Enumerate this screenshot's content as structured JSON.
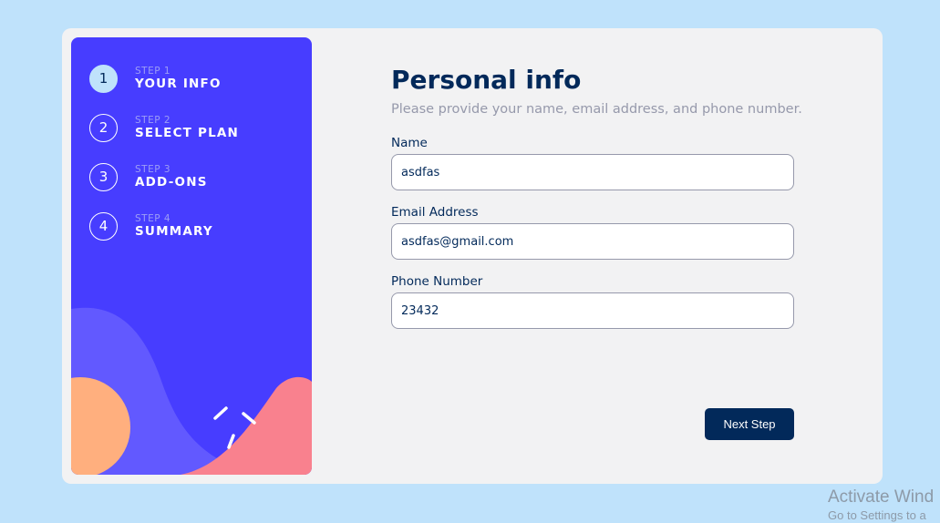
{
  "sidebar": {
    "steps": [
      {
        "number": "1",
        "label": "STEP 1",
        "name": "YOUR INFO",
        "active": true
      },
      {
        "number": "2",
        "label": "STEP 2",
        "name": "SELECT PLAN",
        "active": false
      },
      {
        "number": "3",
        "label": "STEP 3",
        "name": "ADD-ONS",
        "active": false
      },
      {
        "number": "4",
        "label": "STEP 4",
        "name": "SUMMARY",
        "active": false
      }
    ]
  },
  "main": {
    "title": "Personal info",
    "subtitle": "Please provide your name, email address, and phone number.",
    "fields": {
      "name": {
        "label": "Name",
        "value": "asdfas"
      },
      "email": {
        "label": "Email Address",
        "value": "asdfas@gmail.com"
      },
      "phone": {
        "label": "Phone Number",
        "value": "23432"
      }
    },
    "next_label": "Next Step"
  },
  "watermark": {
    "line1": "Activate Wind",
    "line2": "Go to Settings to a"
  },
  "colors": {
    "background": "#bfe2fb",
    "sidebar": "#473dff",
    "marine_blue": "#02295a",
    "active_step": "#bfe2fb",
    "orange": "#ffaf7e",
    "pink": "#f9818e"
  }
}
